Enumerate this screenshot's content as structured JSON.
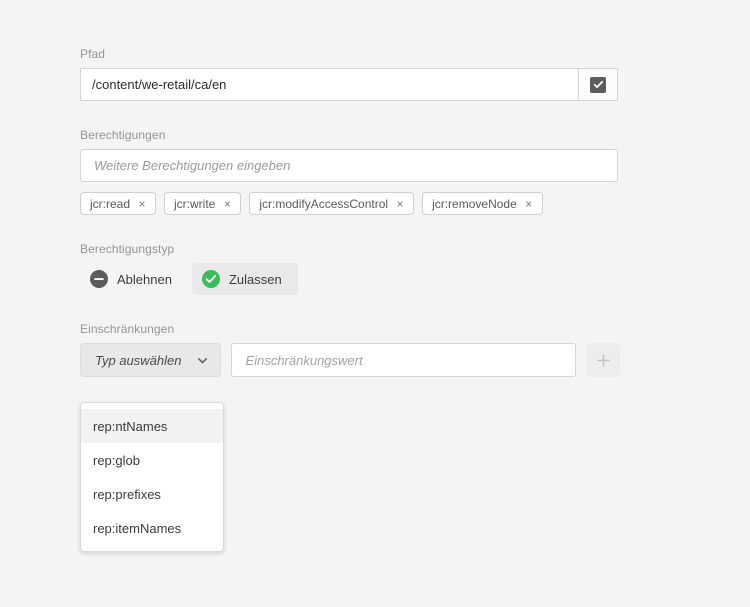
{
  "path": {
    "label": "Pfad",
    "value": "/content/we-retail/ca/en",
    "checkbox_checked": true,
    "checkbox_icon": "checkmark-icon"
  },
  "permissions": {
    "label": "Berechtigungen",
    "placeholder": "Weitere Berechtigungen eingeben",
    "value": "",
    "tags": [
      {
        "label": "jcr:read",
        "remove_icon": "close-icon",
        "remove_label": "×"
      },
      {
        "label": "jcr:write",
        "remove_icon": "close-icon",
        "remove_label": "×"
      },
      {
        "label": "jcr:modifyAccessControl",
        "remove_icon": "close-icon",
        "remove_label": "×"
      },
      {
        "label": "jcr:removeNode",
        "remove_icon": "close-icon",
        "remove_label": "×"
      }
    ]
  },
  "permission_type": {
    "label": "Berechtigungstyp",
    "options": [
      {
        "label": "Ablehnen",
        "icon": "circle-minus-icon",
        "selected": false
      },
      {
        "label": "Zulassen",
        "icon": "circle-check-icon",
        "selected": true
      }
    ],
    "selected_value": "Zulassen"
  },
  "restrictions": {
    "label": "Einschränkungen",
    "type_select": {
      "placeholder": "Typ auswählen",
      "value": "",
      "chevron_icon": "chevron-down-icon",
      "expanded": true
    },
    "value_input": {
      "placeholder": "Einschränkungswert",
      "value": ""
    },
    "add_button": {
      "icon": "plus-icon",
      "label": "+"
    },
    "dropdown_options": [
      {
        "label": "rep:ntNames",
        "highlighted": true
      },
      {
        "label": "rep:glob",
        "highlighted": false
      },
      {
        "label": "rep:prefixes",
        "highlighted": false
      },
      {
        "label": "rep:itemNames",
        "highlighted": false
      }
    ]
  },
  "colors": {
    "page_background": "#f4f4f4",
    "allow_green": "#3cbb5d",
    "deny_gray": "#5c5c5c",
    "label_gray": "#959595",
    "border_gray": "#d4d4d4",
    "selected_background": "#e9e9e9"
  }
}
